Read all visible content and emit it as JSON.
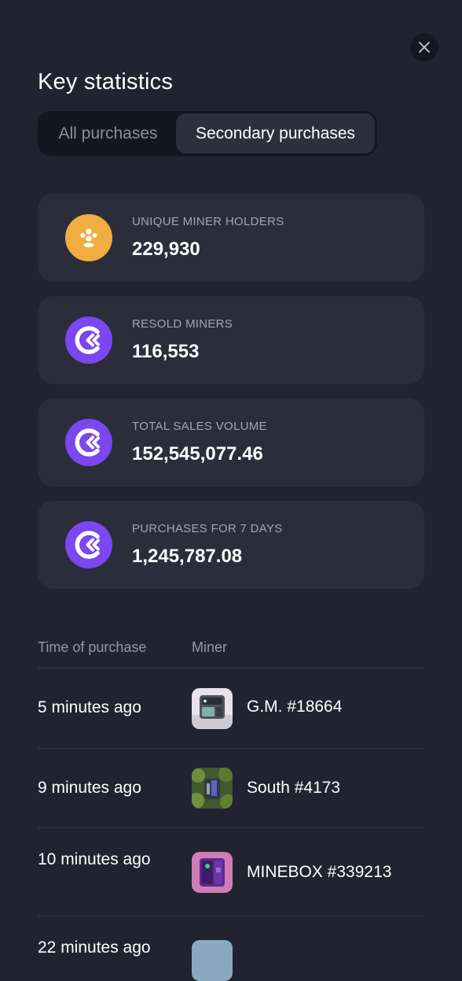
{
  "dialog": {
    "title": "Key statistics",
    "close_icon": "close-icon"
  },
  "tabs": [
    {
      "label": "All purchases",
      "active": false
    },
    {
      "label": "Secondary purchases",
      "active": true
    }
  ],
  "stats": [
    {
      "label": "UNIQUE MINER HOLDERS",
      "value": "229,930",
      "icon": "users-icon",
      "color": "#f1ad3f"
    },
    {
      "label": "RESOLD MINERS",
      "value": "116,553",
      "icon": "rlt-coin-icon",
      "color": "#7a47f0"
    },
    {
      "label": "TOTAL SALES VOLUME",
      "value": "152,545,077.46",
      "icon": "rlt-coin-icon",
      "color": "#7a47f0"
    },
    {
      "label": "PURCHASES FOR 7 DAYS",
      "value": "1,245,787.08",
      "icon": "rlt-coin-icon",
      "color": "#7a47f0"
    }
  ],
  "table": {
    "headers": {
      "time": "Time of purchase",
      "miner": "Miner"
    },
    "rows": [
      {
        "time": "5 minutes ago",
        "miner": "G.M. #18664"
      },
      {
        "time": "9 minutes ago",
        "miner": "South #4173"
      },
      {
        "time": "10 minutes ago",
        "miner": "MINEBOX #339213"
      },
      {
        "time": "22 minutes ago",
        "miner": ""
      }
    ]
  }
}
